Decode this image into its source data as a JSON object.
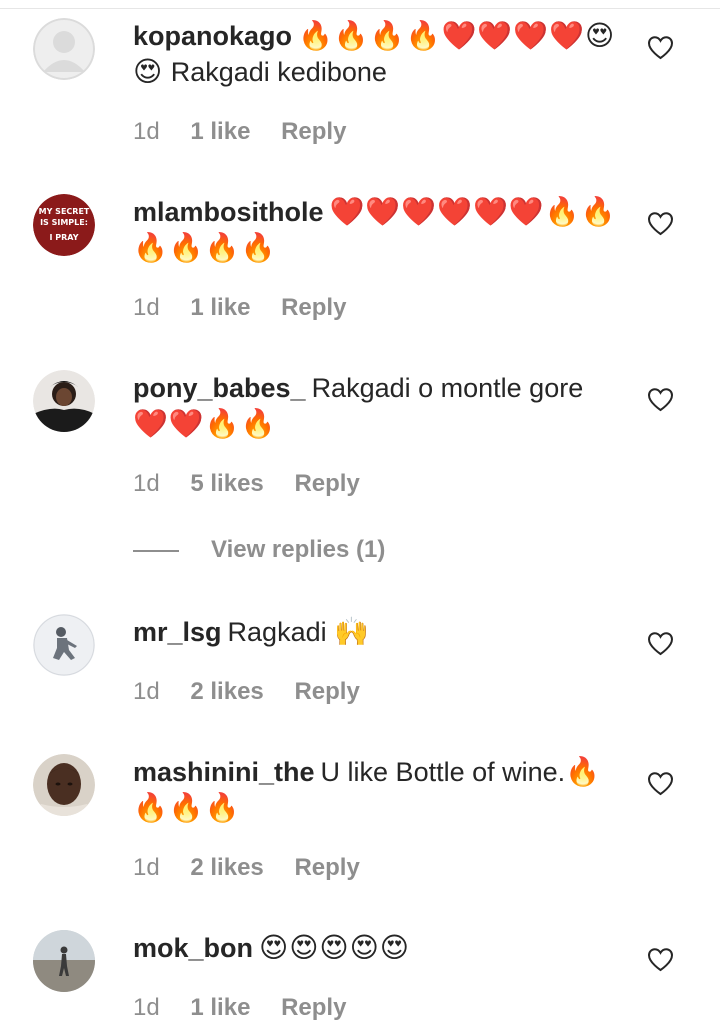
{
  "comments": [
    {
      "username": "kopanokago",
      "text": "Rakgadi kedibone",
      "emoji_line1": "🔥🔥🔥🔥❤️❤️❤️❤️😍",
      "emoji_line2": "😍",
      "time": "1d",
      "likes": "1 like",
      "reply": "Reply"
    },
    {
      "username": "mlambosithole",
      "text": "",
      "emoji_line1": "❤️❤️❤️❤️❤️❤️🔥🔥",
      "emoji_line2": "🔥🔥🔥🔥",
      "avatar_text": [
        "MY SECRET",
        "IS SIMPLE:",
        "I PRAY"
      ],
      "time": "1d",
      "likes": "1 like",
      "reply": "Reply"
    },
    {
      "username": "pony_babes_",
      "text": "Rakgadi o montle gore",
      "emoji_line2": "❤️❤️🔥🔥",
      "time": "1d",
      "likes": "5 likes",
      "reply": "Reply"
    },
    {
      "username": "mr_lsg",
      "text": "Ragkadi",
      "emoji_line1": "🙌",
      "time": "1d",
      "likes": "2 likes",
      "reply": "Reply"
    },
    {
      "username": "mashinini_the",
      "text": "U like Bottle of wine.",
      "emoji_line1": "🔥",
      "emoji_line2": "🔥🔥🔥",
      "time": "1d",
      "likes": "2 likes",
      "reply": "Reply"
    },
    {
      "username": "mok_bon",
      "text": "",
      "emoji_line1": "😍😍😍😍😍",
      "time": "1d",
      "likes": "1 like",
      "reply": "Reply"
    }
  ],
  "view_replies": "View replies (1)",
  "icons": {
    "like": "heart-outline-icon"
  },
  "colors": {
    "text": "#262626",
    "secondary": "#8e8e8e",
    "fire": "#f2870d",
    "heart": "#e0182a",
    "avatar_red": "#8b1a1a"
  }
}
